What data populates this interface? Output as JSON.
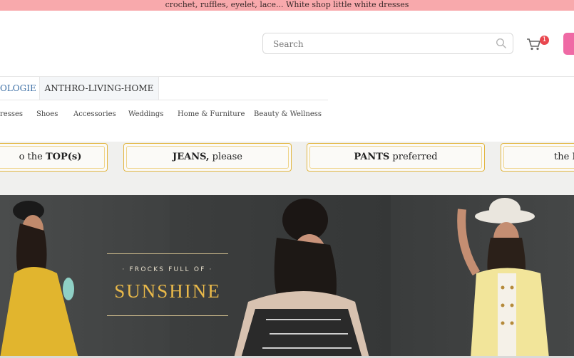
{
  "promo_bar": {
    "text": "crochet, ruffles, eyelet, lace... White shop little white dresses"
  },
  "search": {
    "placeholder": "Search"
  },
  "cart": {
    "count": "1"
  },
  "tabs": [
    {
      "label": "OLOGIE"
    },
    {
      "label": "ANTHRO-LIVING-HOME"
    }
  ],
  "categories": [
    "resses",
    "Shoes",
    "Accessories",
    "Weddings",
    "Home & Furniture",
    "Beauty & Wellness"
  ],
  "promo_pills": [
    {
      "prefix": "o the ",
      "bold": "TOP(s)",
      "suffix": ""
    },
    {
      "prefix": "",
      "bold": "JEANS,",
      "suffix": " please"
    },
    {
      "prefix": "",
      "bold": "PANTS",
      "suffix": " preferred"
    },
    {
      "prefix": "the ",
      "bold": "D",
      "suffix": ""
    }
  ],
  "hero": {
    "kicker": "· FROCKS FULL OF ·",
    "headline": "SUNSHINE"
  },
  "colors": {
    "promo_bg": "#f8a9ac",
    "accent_gold": "#e2b640",
    "tab_active": "#3b6ea5",
    "badge": "#e9474f"
  }
}
